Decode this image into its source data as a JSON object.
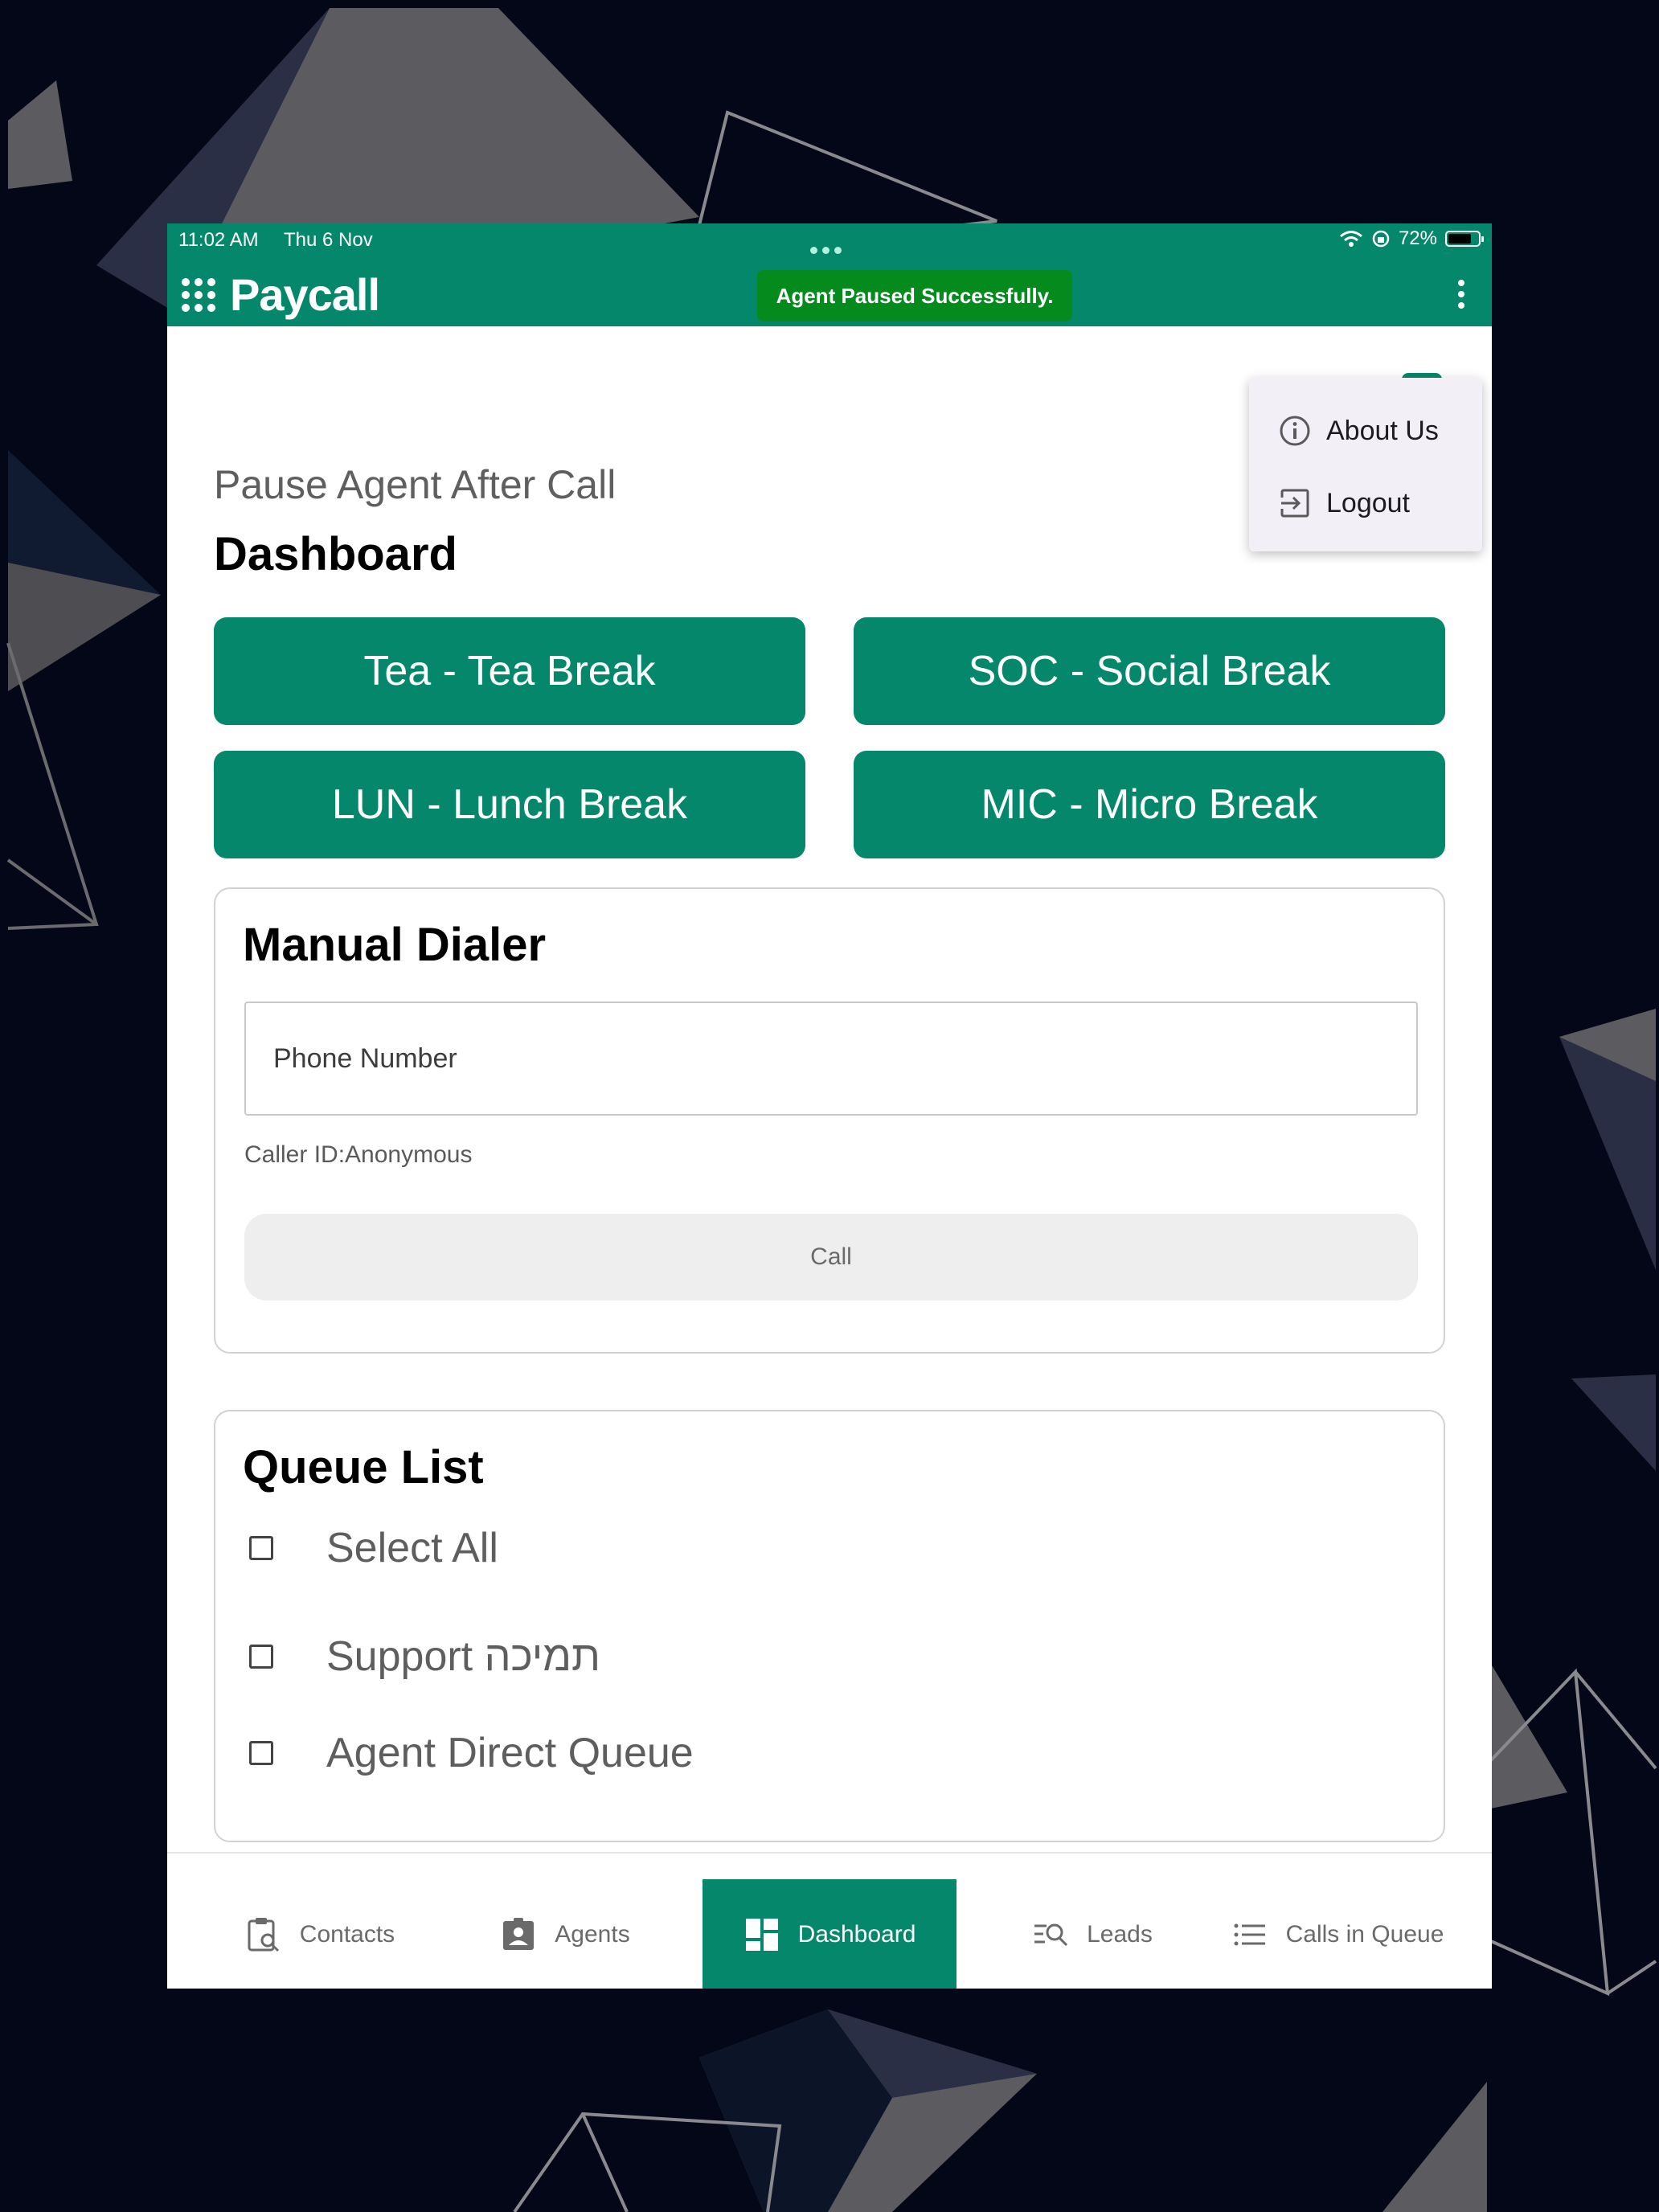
{
  "status_bar": {
    "time": "11:02 AM",
    "date": "Thu 6 Nov",
    "battery": "72%"
  },
  "app_bar": {
    "logo_text": "Paycall",
    "toast": "Agent Paused Successfully."
  },
  "menu": {
    "items": [
      {
        "label": "About Us",
        "icon": "info-icon"
      },
      {
        "label": "Logout",
        "icon": "logout-icon"
      }
    ]
  },
  "page": {
    "subtitle": "Pause Agent After Call",
    "title": "Dashboard"
  },
  "breaks": [
    "Tea - Tea Break",
    "SOC - Social Break",
    "LUN - Lunch Break",
    "MIC - Micro Break"
  ],
  "manual_dialer": {
    "title": "Manual Dialer",
    "phone_placeholder": "Phone Number",
    "phone_value": "",
    "caller_id": "Caller ID:Anonymous",
    "call_label": "Call"
  },
  "queue_list": {
    "title": "Queue List",
    "items": [
      "Select All",
      "Support תמיכה",
      "Agent Direct Queue"
    ]
  },
  "bottom_nav": {
    "active": "Dashboard",
    "items": [
      {
        "label": "Contacts",
        "icon": "clipboard-search-icon"
      },
      {
        "label": "Agents",
        "icon": "agent-badge-icon"
      },
      {
        "label": "Dashboard",
        "icon": "dashboard-icon"
      },
      {
        "label": "Leads",
        "icon": "list-search-icon"
      },
      {
        "label": "Calls in Queue",
        "icon": "list-icon"
      }
    ]
  },
  "colors": {
    "brand": "#04876a",
    "toast": "#058a1d",
    "background": "#040717"
  }
}
